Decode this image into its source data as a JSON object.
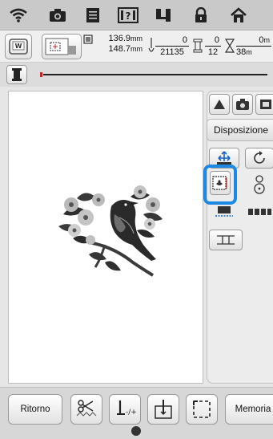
{
  "topbar": {
    "icons": [
      "wifi-icon",
      "camera-icon",
      "document-icon",
      "help-icon",
      "settings-icon",
      "lock-icon",
      "home-icon"
    ]
  },
  "infobar": {
    "size_width": "136.9",
    "size_height": "148.7",
    "unit": "mm",
    "stitch_current": "0",
    "stitch_total": "21135",
    "color_current": "0",
    "color_total": "12",
    "time_current": "0",
    "time_total": "38",
    "time_unit": "m"
  },
  "side": {
    "tab_label": "Disposizione"
  },
  "bottom": {
    "ritorno_label": "Ritorno",
    "memoria_label": "Memoria"
  },
  "colors": {
    "highlight": "#1e88e5",
    "thread_red": "#c62828",
    "thread_blue": "#1565c0"
  }
}
